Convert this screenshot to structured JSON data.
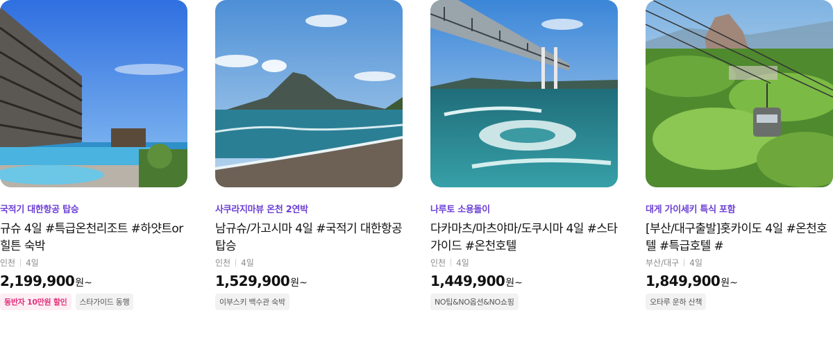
{
  "cards": [
    {
      "tagline": "국적기 대한항공 탑승",
      "title": "규슈 4일 #특급온천리조트 #하얏트or힐튼 숙박",
      "city": "인천",
      "duration": "4일",
      "price": "2,199,900",
      "unit": "원~",
      "badges": [
        "동반자 10만원 할인",
        "스타가이드 동행"
      ],
      "image": "resort-pool-photo"
    },
    {
      "tagline": "사쿠라지마뷰 온천 2연박",
      "title": "남규슈/가고시마 4일 #국적기 대한항공 탑승",
      "city": "인천",
      "duration": "4일",
      "price": "1,529,900",
      "unit": "원~",
      "badges": [
        "이부스키 백수관 숙박"
      ],
      "image": "volcano-beach-photo"
    },
    {
      "tagline": "나루토 소용돌이",
      "title": "다카마츠/마츠야마/도쿠시마 4일 #스타가이드 #온천호텔",
      "city": "인천",
      "duration": "4일",
      "price": "1,449,900",
      "unit": "원~",
      "badges": [
        "NO팁&NO옵션&NO쇼핑"
      ],
      "image": "bridge-whirlpool-photo"
    },
    {
      "tagline": "대게 가이세키 특식 포함",
      "title": "[부산/대구출발]홋카이도 4일 #온천호텔 #특급호텔 #",
      "city": "부산/대구",
      "duration": "4일",
      "price": "1,849,900",
      "unit": "원~",
      "badges": [
        "오타루 운하 산책"
      ],
      "image": "ropeway-forest-photo"
    }
  ],
  "colors": {
    "tagline": "#6b3fd4",
    "pink_badge_text": "#e0307a",
    "pink_badge_bg": "#fdeef4",
    "gray_badge_bg": "#f2f2f2"
  }
}
